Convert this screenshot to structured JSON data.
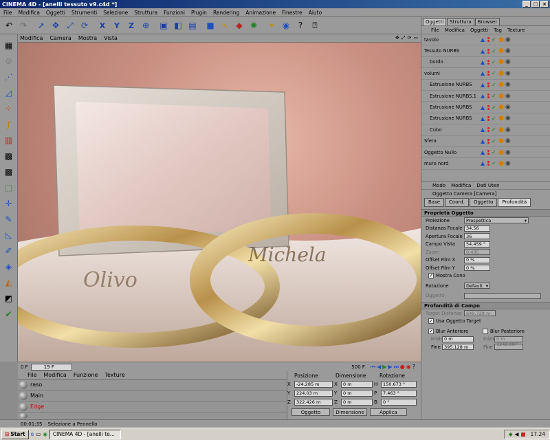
{
  "window": {
    "title": "CINEMA 4D - [anelli tessuto v9.c4d *]"
  },
  "menubar": [
    "File",
    "Modifica",
    "Oggetti",
    "Strumenti",
    "Selezione",
    "Struttura",
    "Funzioni",
    "Plugin",
    "Rendering",
    "Animazione",
    "Finestre",
    "Aiuto"
  ],
  "viewport": {
    "menu": [
      "Modifica",
      "Camera",
      "Mostra",
      "Vista"
    ]
  },
  "render_text": {
    "ring_left": "Olivo",
    "ring_right": "Michela"
  },
  "timeline": {
    "start": "0 F",
    "frame": "19 F",
    "end": "500 F"
  },
  "materials": {
    "menu": [
      "File",
      "Modifica",
      "Funzione",
      "Texture"
    ],
    "items": [
      {
        "name": "raso",
        "color": "#000000"
      },
      {
        "name": "Main",
        "color": "#000000"
      },
      {
        "name": "Edge",
        "color": "#c00000"
      }
    ]
  },
  "coords": {
    "headers": [
      "Posizione",
      "Dimensione",
      "Rotazione"
    ],
    "rows": [
      {
        "axis": "X",
        "pos": "-24.285 m",
        "dim": "0 m",
        "rot_axis": "H",
        "rot": "150.673 °"
      },
      {
        "axis": "Y",
        "pos": "224.03 m",
        "dim": "0 m",
        "rot_axis": "P",
        "rot": "7.463 °"
      },
      {
        "axis": "Z",
        "pos": "322.426 m",
        "dim": "0 m",
        "rot_axis": "B",
        "rot": "0 °"
      }
    ],
    "buttons": {
      "mode": "Oggetto",
      "size": "Dimensione",
      "apply": "Applica"
    }
  },
  "status": {
    "time": "00:01:35",
    "message": "Selezione a Pennello"
  },
  "object_manager": {
    "tabs": [
      "Oggetti",
      "Struttura",
      "Browser"
    ],
    "menu": [
      "File",
      "Modifica",
      "Oggetti",
      "Tag",
      "Texture"
    ],
    "objects": [
      {
        "name": "tavolo",
        "indent": 0
      },
      {
        "name": "Tessuto NURBS",
        "indent": 0
      },
      {
        "name": "bordo",
        "indent": 1
      },
      {
        "name": "volumi",
        "indent": 0
      },
      {
        "name": "Estrusione NURBS",
        "indent": 1
      },
      {
        "name": "Estrusione NURBS.1",
        "indent": 1
      },
      {
        "name": "Estrusione NURBS",
        "indent": 1
      },
      {
        "name": "Estrusione NURBS",
        "indent": 1
      },
      {
        "name": "Cubo",
        "indent": 1
      },
      {
        "name": "Sfera",
        "indent": 0
      },
      {
        "name": "Oggetto Nullo",
        "indent": 0
      },
      {
        "name": "muro nord",
        "indent": 0
      }
    ]
  },
  "attributes": {
    "menu": [
      "Modo",
      "Modifica",
      "Dati Uten"
    ],
    "object_title": "Oggetto Camera [Camera]",
    "tabs": [
      "Base",
      "Coord.",
      "Oggetto",
      "Profondità"
    ],
    "section_object": "Proprietà Oggetto",
    "projection_label": "Proiezione",
    "projection_value": "Prospettica",
    "focal_label": "Distanza Focale",
    "focal_value": "34.56",
    "aperture_label": "Apertura Focale",
    "aperture_value": "36",
    "fov_label": "Campo Vista",
    "fov_value": "54.459 °",
    "zoom_label": "Zoom",
    "zoom_value": "0.435",
    "offx_label": "Offset Film X",
    "offx_value": "0 %",
    "offy_label": "Offset Film Y",
    "offy_value": "0 %",
    "show_cone": "Mostra Cono",
    "rotation_label": "Rotazione",
    "rotation_value": "Default",
    "object_label": "Oggetto",
    "section_dof": "Profondità di Campo",
    "target_dist_label": "Target Distanza",
    "target_dist_value": "649.728 m",
    "use_target": "Usa Oggetto Target",
    "blur_front": "Blur Anteriore",
    "blur_back": "Blur Posteriore",
    "start_label": "Inizio",
    "start_value": "0 m",
    "start2_value": "0 m",
    "end_label": "Fine",
    "end_value": "395.128 m",
    "end2_value": "1242.887 m"
  },
  "taskbar": {
    "start": "Start",
    "task": "CINEMA 4D - [anelli te...",
    "clock": "17.24"
  },
  "colors": {
    "accent": "#0a246a",
    "panel": "#9a9a9a",
    "active_check": "#0a7a0a",
    "red_dot": "#d42020"
  }
}
